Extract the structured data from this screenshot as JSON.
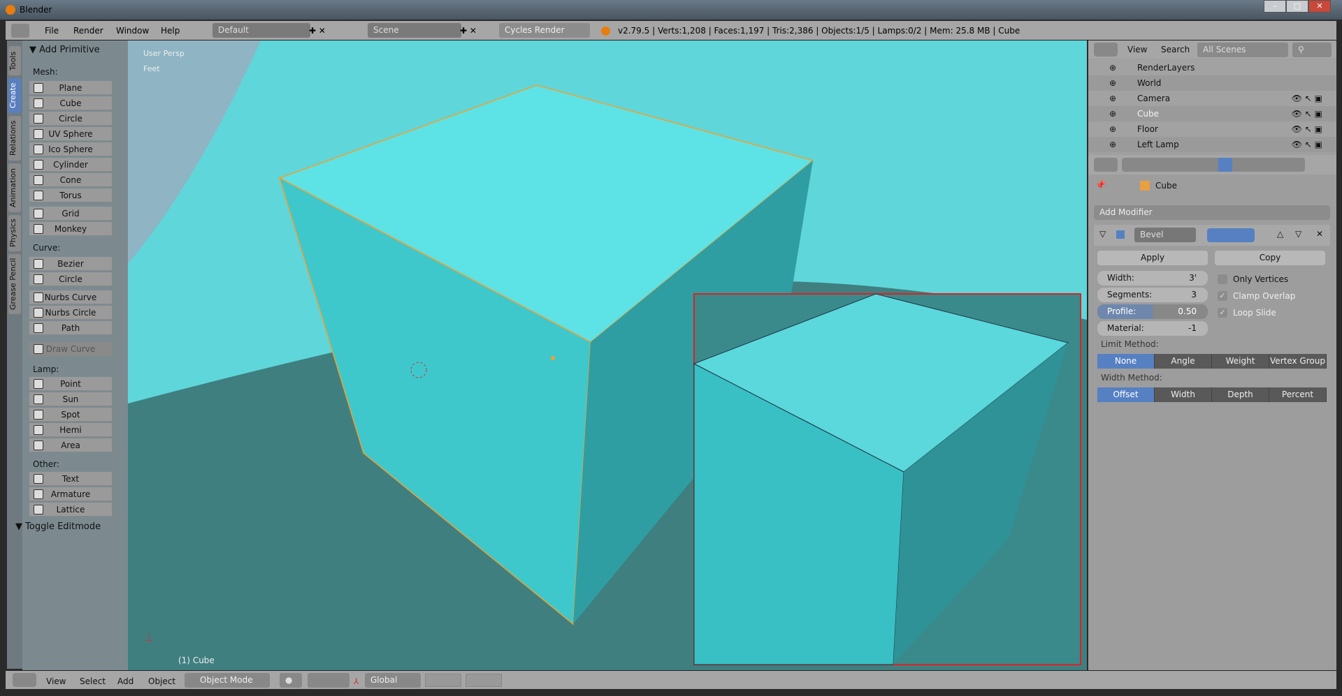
{
  "window": {
    "title": "Blender"
  },
  "topbar": {
    "menus": [
      "File",
      "Render",
      "Window",
      "Help"
    ],
    "screen": "Default",
    "scene": "Scene",
    "engine": "Cycles Render",
    "stats": "v2.79.5 | Verts:1,208 | Faces:1,197 | Tris:2,386 | Objects:1/5 | Lamps:0/2 | Mem: 25.8 MB | Cube"
  },
  "tabs": [
    "Tools",
    "Create",
    "Relations",
    "Animation",
    "Physics",
    "Grease Pencil"
  ],
  "active_tab": "Create",
  "shelf": {
    "panel": "Add Primitive",
    "mesh_label": "Mesh:",
    "mesh": [
      "Plane",
      "Cube",
      "Circle",
      "UV Sphere",
      "Ico Sphere",
      "Cylinder",
      "Cone",
      "Torus",
      "Grid",
      "Monkey"
    ],
    "curve_label": "Curve:",
    "curve": [
      "Bezier",
      "Circle",
      "Nurbs Curve",
      "Nurbs Circle",
      "Path",
      "Draw Curve"
    ],
    "lamp_label": "Lamp:",
    "lamp": [
      "Point",
      "Sun",
      "Spot",
      "Hemi",
      "Area"
    ],
    "other_label": "Other:",
    "other": [
      "Text",
      "Armature",
      "Lattice"
    ],
    "toggle": "Toggle Editmode"
  },
  "viewport": {
    "view": "User Persp",
    "units": "Feet",
    "object": "(1) Cube",
    "accent": "#4fd8dc",
    "selection": "#f0a030",
    "inset_border": "#e02020"
  },
  "outliner": {
    "view": "View",
    "search": "Search",
    "filter": "All Scenes",
    "rows": [
      "RenderLayers",
      "World",
      "Camera",
      "Cube",
      "Floor",
      "Left Lamp"
    ]
  },
  "props": {
    "breadcrumb": "Cube",
    "add_modifier": "Add Modifier",
    "modifier_name": "Bevel",
    "apply": "Apply",
    "copy": "Copy",
    "width_label": "Width:",
    "width": "3'",
    "segments_label": "Segments:",
    "segments": "3",
    "profile_label": "Profile:",
    "profile": "0.50",
    "profile_fraction": 0.5,
    "material_label": "Material:",
    "material": "-1",
    "only_vertices": "Only Vertices",
    "only_vertices_checked": false,
    "clamp_overlap": "Clamp Overlap",
    "clamp_checked": true,
    "loop_slide": "Loop Slide",
    "loop_checked": true,
    "limit_label": "Limit Method:",
    "limit": [
      "None",
      "Angle",
      "Weight",
      "Vertex Group"
    ],
    "width_method_label": "Width Method:",
    "width_method": [
      "Offset",
      "Width",
      "Depth",
      "Percent"
    ]
  },
  "bottombar": {
    "menus": [
      "View",
      "Select",
      "Add",
      "Object"
    ],
    "mode": "Object Mode",
    "orientation": "Global"
  }
}
